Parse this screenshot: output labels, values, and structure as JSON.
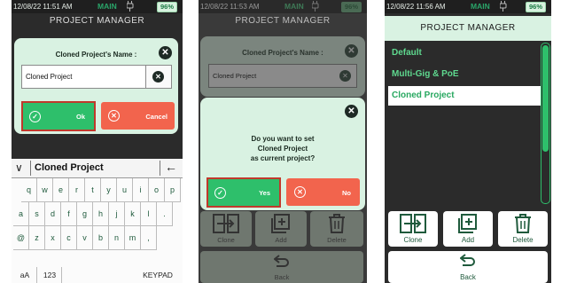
{
  "colors": {
    "accent_green": "#2ebf6b",
    "cancel_red": "#f2644d",
    "dialog_bg": "#d9f2e2",
    "highlight_border": "#c0392b"
  },
  "screens": [
    {
      "status": {
        "time": "12/08/22 11:51 AM",
        "mode": "MAIN",
        "battery": "96%"
      },
      "title": "PROJECT MANAGER",
      "dialog": {
        "title": "Cloned Project's Name :",
        "field_value": "Cloned Project",
        "ok_label": "Ok",
        "cancel_label": "Cancel"
      },
      "keyboard": {
        "input_text": "Cloned Project",
        "row1": [
          "q",
          "w",
          "e",
          "r",
          "t",
          "y",
          "u",
          "i",
          "o",
          "p"
        ],
        "row2": [
          "a",
          "s",
          "d",
          "f",
          "g",
          "h",
          "j",
          "k",
          "l",
          "."
        ],
        "row3": [
          "@",
          "z",
          "x",
          "c",
          "v",
          "b",
          "n",
          "m",
          ","
        ],
        "mode_label": "aA",
        "numbers_label": "123",
        "keypad_label": "KEYPAD"
      }
    },
    {
      "status": {
        "time": "12/08/22 11:53 AM",
        "mode": "MAIN",
        "battery": "96%"
      },
      "title": "PROJECT MANAGER",
      "bg_dialog_title": "Cloned Project's Name :",
      "bg_field_value": "Cloned Project",
      "dialog": {
        "question_line1": "Do you want to set",
        "question_line2": "Cloned Project",
        "question_line3": "as current project?",
        "yes_label": "Yes",
        "no_label": "No"
      },
      "actions": {
        "clone": "Clone",
        "add": "Add",
        "delete": "Delete",
        "back": "Back"
      }
    },
    {
      "status": {
        "time": "12/08/22 11:56 AM",
        "mode": "MAIN",
        "battery": "96%"
      },
      "title": "PROJECT MANAGER",
      "projects": [
        "Default",
        "Multi-Gig & PoE",
        "Cloned Project"
      ],
      "selected_project": "Cloned Project",
      "actions": {
        "clone": "Clone",
        "add": "Add",
        "delete": "Delete",
        "back": "Back"
      }
    }
  ]
}
